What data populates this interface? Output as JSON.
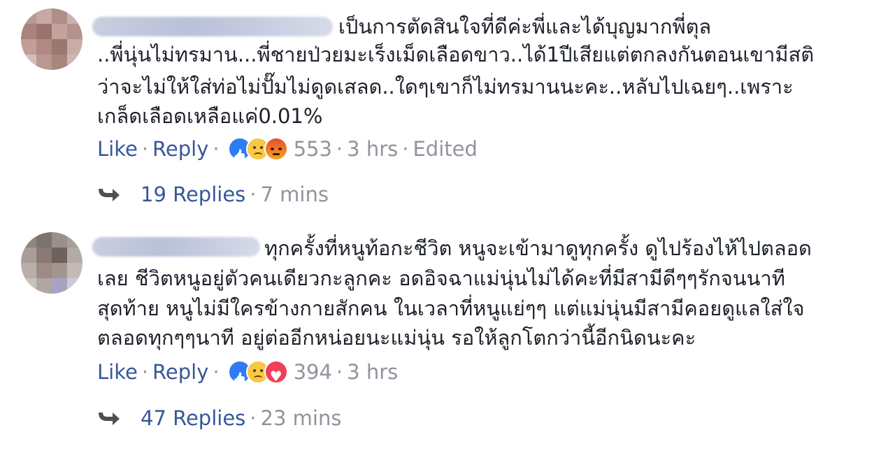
{
  "comments": [
    {
      "lines": [
        "เป็นการตัดสินใจที่ดีค่ะพี่และได้บุญมากพี่ตุล",
        "..พี่นุ่นไม่ทรมาน...พี่ชายป่วยมะเร็งเม็ดเลือดขาว..ได้1ปีเสียแต่ตกลงกันตอนเขามีสติ",
        "ว่าจะไม่ให้ใส่ท่อไม่ปั๊มไม่ดูดเสลด..ใดๆเขาก็ไม่ทรมานนะคะ..หลับไปเฉยๆ..เพราะ",
        "เกล็ดเลือดเหลือแค่0.01%"
      ],
      "like_label": "Like",
      "reply_label": "Reply",
      "reactions": [
        "like",
        "sad",
        "angry"
      ],
      "reaction_count": "553",
      "time": "3 hrs",
      "edited_label": "Edited",
      "replies_label": "19 Replies",
      "replies_time": "7 mins"
    },
    {
      "lines": [
        "ทุกครั้งที่หนูท้อกะชีวิต หนูจะเข้ามาดูทุกครั้ง ดูไปร้องไห้ไปตลอด",
        "เลย ชีวิตหนูอยู่ตัวคนเดียวกะลูกคะ อดอิจฉาแม่นุ่นไม่ได้คะที่มีสามีดีๆๆรักจนนาที",
        "สุดท้าย หนูไม่มีใครข้างกายสักคน ในเวลาที่หนูแย่ๆๆ แต่แม่นุ่นมีสามีคอยดูแลใส่ใจ",
        "ตลอดทุกๆๆนาที อยู่ต่ออีกหน่อยนะแม่นุ่น รอให้ลูกโตกว่านี้อีกนิดนะคะ"
      ],
      "like_label": "Like",
      "reply_label": "Reply",
      "reactions": [
        "like",
        "sad",
        "love"
      ],
      "reaction_count": "394",
      "time": "3 hrs",
      "replies_label": "47 Replies",
      "replies_time": "23 mins"
    }
  ],
  "colors": {
    "link": "#365899",
    "meta": "#90949c",
    "text": "#1d2129"
  }
}
